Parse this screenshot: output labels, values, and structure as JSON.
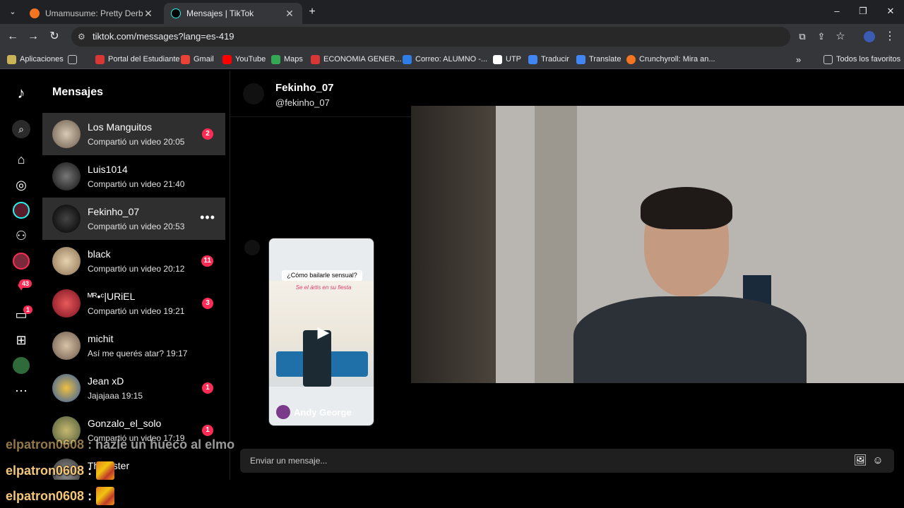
{
  "browser": {
    "tabs": [
      {
        "title": "Umamusume: Pretty Derby en ",
        "active": false,
        "icon": "crunchyroll-icon"
      },
      {
        "title": "Mensajes | TikTok",
        "active": true,
        "icon": "tiktok-icon"
      }
    ],
    "url": "tiktok.com/messages?lang=es-419",
    "bookmarks": [
      "Aplicaciones",
      "Portal del Estudiante",
      "Gmail",
      "YouTube",
      "Maps",
      "ECONOMIA GENER...",
      "Correo: ALUMNO -...",
      "UTP",
      "Traducir",
      "Translate",
      "Crunchyroll: Mira an..."
    ],
    "all_bookmarks": "Todos los favoritos"
  },
  "sidebar": {
    "badges": {
      "activity": "43",
      "inbox": "1"
    }
  },
  "conversations": {
    "title": "Mensajes",
    "items": [
      {
        "name": "Los Manguitos",
        "preview": "Compartió un video 20:05",
        "unread": "2"
      },
      {
        "name": "Luis1014",
        "preview": "Compartió un video 21:40",
        "unread": ""
      },
      {
        "name": "Fekinho_07",
        "preview": "Compartió un video 20:53",
        "unread": ""
      },
      {
        "name": "black",
        "preview": "Compartió un video 20:12",
        "unread": "11"
      },
      {
        "name": "ᴹᴿ•ᶜ|URiEL",
        "preview": "Compartió un video 19:21",
        "unread": "3"
      },
      {
        "name": "michit",
        "preview": "Así me querés atar? 19:17",
        "unread": ""
      },
      {
        "name": "Jean xD",
        "preview": "Jajajaaa 19:15",
        "unread": "1"
      },
      {
        "name": "Gonzalo_el_solo",
        "preview": "Compartió un video 17:19",
        "unread": "1"
      },
      {
        "name": "The...ster",
        "preview": "",
        "unread": ""
      }
    ]
  },
  "chat": {
    "name": "Fekinho_07",
    "handle": "@fekinho_07",
    "video": {
      "caption": "¿Cómo bailarle sensual?",
      "subcaption": "Se el ártis en su fiesta",
      "author": "Andy George"
    },
    "composer_placeholder": "Enviar un mensaje..."
  },
  "stream_chat": [
    {
      "user": "elpatron0608",
      "text": ": hazle un hueco al elmo"
    },
    {
      "user": "elpatron0608",
      "text": ":"
    },
    {
      "user": "elpatron0608",
      "text": ":"
    }
  ]
}
